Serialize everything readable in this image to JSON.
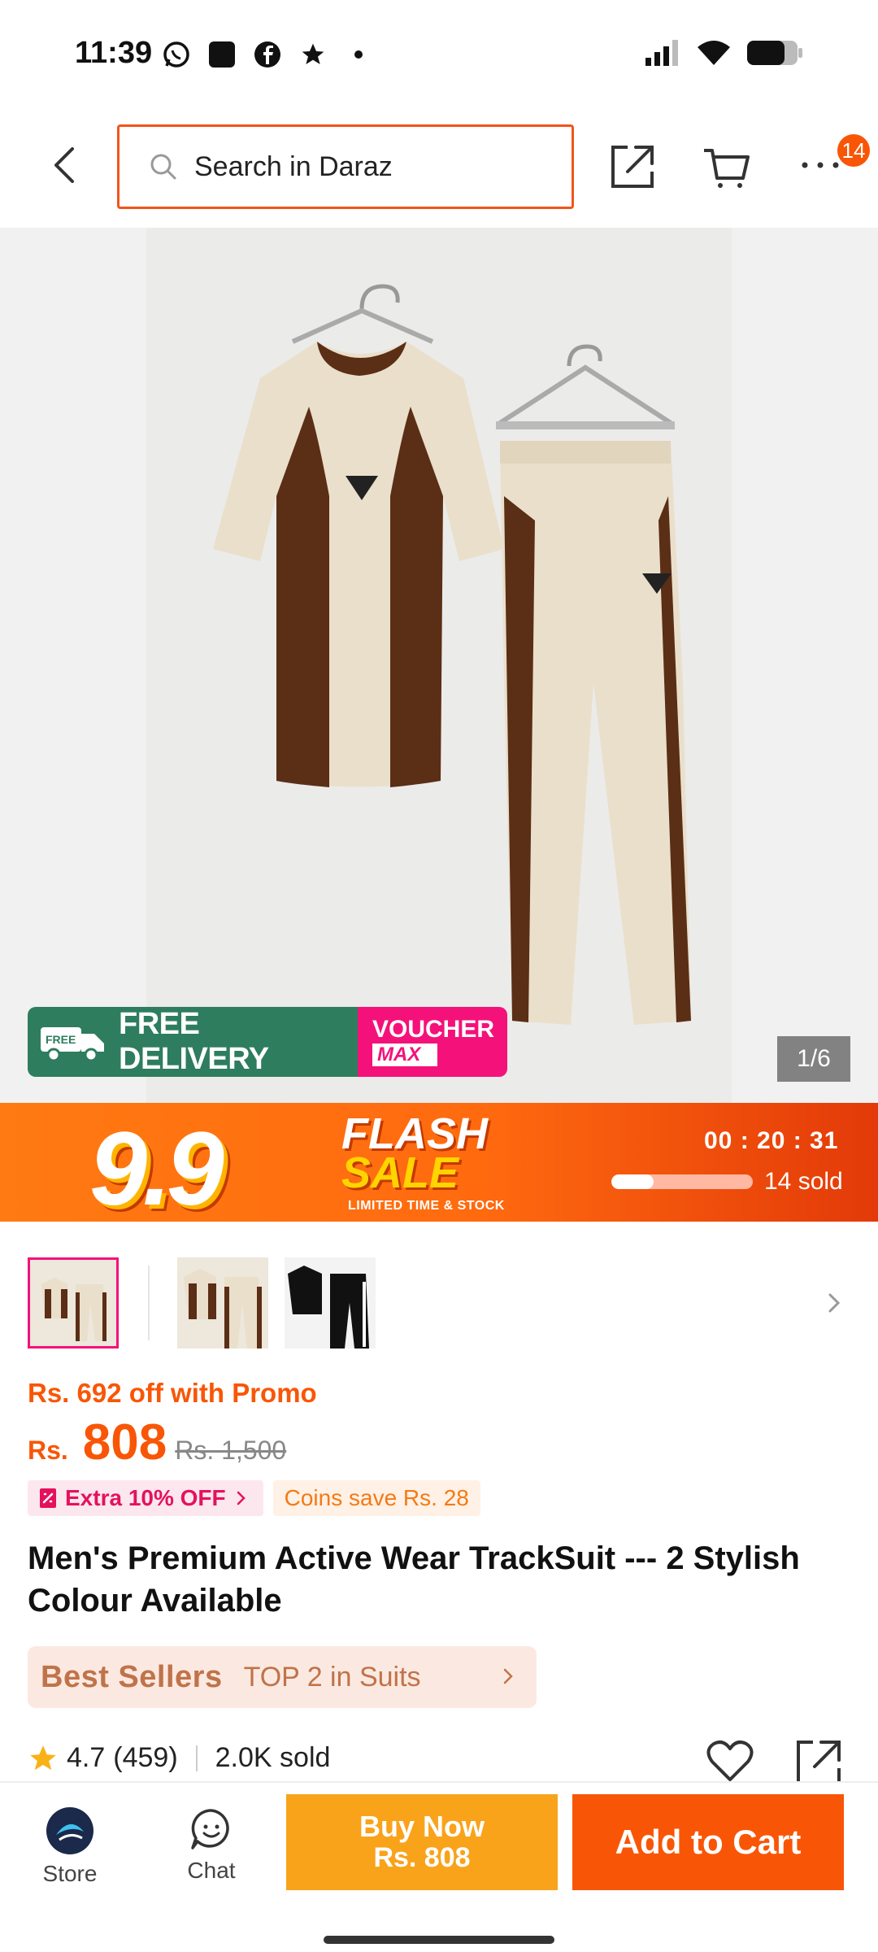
{
  "status_bar": {
    "time": "11:39",
    "left_icons": [
      "whatsapp-icon",
      "app-icon",
      "facebook-icon",
      "star-icon",
      "dot-icon"
    ],
    "right_icons": [
      "signal-icon",
      "wifi-icon",
      "battery-icon"
    ]
  },
  "header": {
    "search_placeholder": "Search in Daraz",
    "more_badge": "14"
  },
  "gallery": {
    "counter": "1/6",
    "free_delivery_badge": "FREE",
    "free_delivery_label": "FREE DELIVERY",
    "voucher_top": "VOUCHER",
    "voucher_bottom": "MAX"
  },
  "flash_sale": {
    "event_label": "9.9",
    "flash_word": "FLASH",
    "sale_word": "SALE",
    "tagline": "LIMITED TIME & STOCK",
    "timer": "00 : 20 : 31",
    "sold_progress": 0.3,
    "sold_text": "14 sold"
  },
  "product": {
    "promo_off": "Rs. 692 off with Promo",
    "currency": "Rs.",
    "price": "808",
    "original_price": "Rs. 1,500",
    "tag_extra": "Extra 10% OFF",
    "tag_coins": "Coins save Rs. 28",
    "title": "Men's Premium Active Wear TrackSuit --- 2 Stylish Colour Available",
    "bestseller_logo": "Best Sellers",
    "bestseller_text": "TOP 2 in Suits",
    "rating": "4.7",
    "reviews": "(459)",
    "sold": "2.0K sold"
  },
  "bottom_bar": {
    "store_label": "Store",
    "chat_label": "Chat",
    "buy_now_label": "Buy Now",
    "buy_now_price": "Rs. 808",
    "add_to_cart_label": "Add to Cart"
  },
  "colors": {
    "accent": "#f85606",
    "buy_now": "#f9a31b",
    "voucher": "#f4127a",
    "free_delivery": "#2e7d5e"
  }
}
